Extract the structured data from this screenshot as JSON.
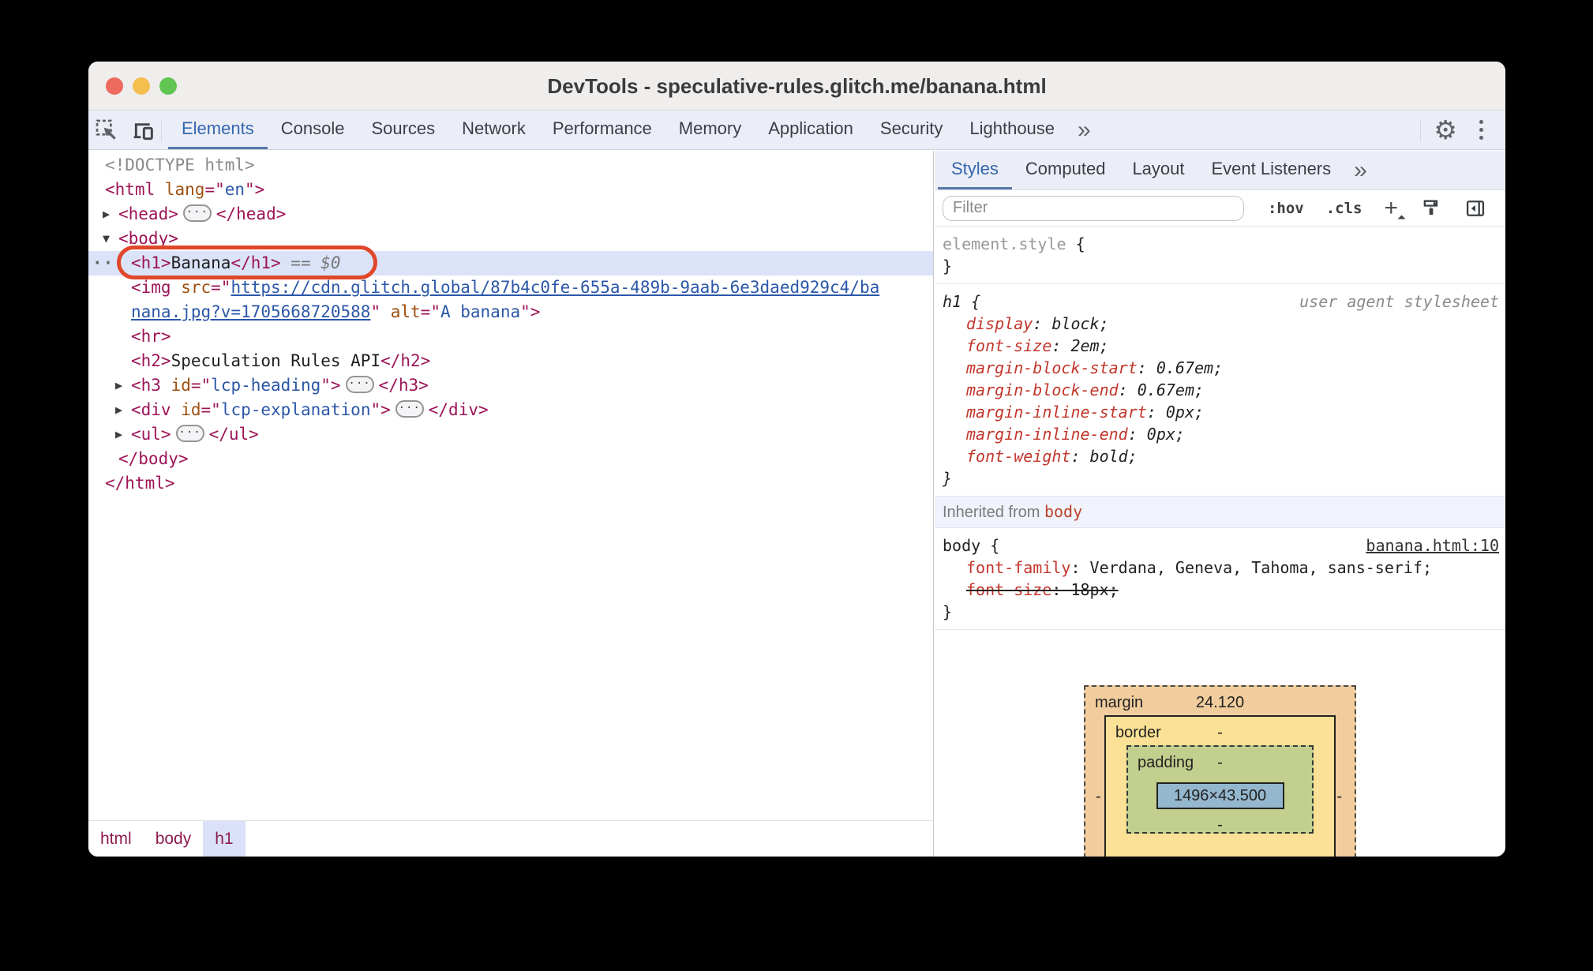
{
  "window": {
    "title": "DevTools - speculative-rules.glitch.me/banana.html"
  },
  "toolbar": {
    "tabs": [
      {
        "label": "Elements",
        "selected": true
      },
      {
        "label": "Console"
      },
      {
        "label": "Sources"
      },
      {
        "label": "Network"
      },
      {
        "label": "Performance"
      },
      {
        "label": "Memory"
      },
      {
        "label": "Application"
      },
      {
        "label": "Security"
      },
      {
        "label": "Lighthouse"
      }
    ],
    "more": "»"
  },
  "right_tabs": {
    "tabs": [
      {
        "label": "Styles",
        "selected": true
      },
      {
        "label": "Computed"
      },
      {
        "label": "Layout"
      },
      {
        "label": "Event Listeners"
      }
    ],
    "more": "»"
  },
  "styles_toolbar": {
    "filter_placeholder": "Filter",
    "pseudo": ":hov",
    "classes": ".cls",
    "plus": "+"
  },
  "rules": {
    "element_style": {
      "selector": "element.style",
      "open": " {",
      "close": "}"
    },
    "h1": {
      "selector": "h1 {",
      "origin": "user agent stylesheet",
      "close": "}",
      "decls": [
        {
          "name": "display",
          "value": "block"
        },
        {
          "name": "font-size",
          "value": "2em"
        },
        {
          "name": "margin-block-start",
          "value": "0.67em"
        },
        {
          "name": "margin-block-end",
          "value": "0.67em"
        },
        {
          "name": "margin-inline-start",
          "value": "0px"
        },
        {
          "name": "margin-inline-end",
          "value": "0px"
        },
        {
          "name": "font-weight",
          "value": "bold"
        }
      ]
    },
    "inherited": {
      "prefix": "Inherited from ",
      "node": "body"
    },
    "body": {
      "selector": "body {",
      "origin": "banana.html:10",
      "close": "}",
      "decls": [
        {
          "name": "font-family",
          "value": "Verdana, Geneva, Tahoma, sans-serif"
        },
        {
          "name": "font-size",
          "value": "18px",
          "strike": true
        }
      ]
    }
  },
  "box_model": {
    "margin_label": "margin",
    "margin_top": "24.120",
    "border_label": "border",
    "padding_label": "padding",
    "content_size": "1496×43.500",
    "dash": "-"
  },
  "breadcrumbs": [
    {
      "label": "html"
    },
    {
      "label": "body"
    },
    {
      "label": "h1",
      "active": true
    }
  ],
  "dom": {
    "rows": [
      {
        "indent": 0,
        "tokens": [
          {
            "g": "<!DOCTYPE html>"
          }
        ]
      },
      {
        "indent": 0,
        "tokens": [
          {
            "t": "<html "
          },
          {
            "a": "lang"
          },
          {
            "t": "=\""
          },
          {
            "v": "en"
          },
          {
            "t": "\">"
          }
        ]
      },
      {
        "indent": 1,
        "arrow": "▶",
        "tokens": [
          {
            "t": "<head>"
          },
          {
            "e": "···"
          },
          {
            "t": "</head>"
          }
        ]
      },
      {
        "indent": 1,
        "arrow": "▼",
        "tokens": [
          {
            "t": "<body>"
          }
        ]
      },
      {
        "indent": 2,
        "selected": true,
        "annotate": true,
        "gutter": "···",
        "tokens": [
          {
            "t": "<h1>"
          },
          {
            "p": "Banana"
          },
          {
            "t": "</h1>"
          },
          {
            "d": " == $0"
          }
        ]
      },
      {
        "indent": 2,
        "tokens": [
          {
            "t": "<img "
          },
          {
            "a": "src"
          },
          {
            "t": "=\""
          },
          {
            "l": "https://cdn.glitch.global/87b4c0fe-655a-489b-9aab-6e3daed929c4/ba"
          }
        ]
      },
      {
        "indent": 2,
        "tokens": [
          {
            "l": "nana.jpg?v=1705668720588"
          },
          {
            "t": "\" "
          },
          {
            "a": "alt"
          },
          {
            "t": "=\""
          },
          {
            "v": "A banana"
          },
          {
            "t": "\">"
          }
        ]
      },
      {
        "indent": 2,
        "tokens": [
          {
            "t": "<hr>"
          }
        ]
      },
      {
        "indent": 2,
        "tokens": [
          {
            "t": "<h2>"
          },
          {
            "p": "Speculation Rules API"
          },
          {
            "t": "</h2>"
          }
        ]
      },
      {
        "indent": 2,
        "arrow": "▶",
        "tokens": [
          {
            "t": "<h3 "
          },
          {
            "a": "id"
          },
          {
            "t": "=\""
          },
          {
            "v": "lcp-heading"
          },
          {
            "t": "\">"
          },
          {
            "e": "···"
          },
          {
            "t": "</h3>"
          }
        ]
      },
      {
        "indent": 2,
        "arrow": "▶",
        "tokens": [
          {
            "t": "<div "
          },
          {
            "a": "id"
          },
          {
            "t": "=\""
          },
          {
            "v": "lcp-explanation"
          },
          {
            "t": "\">"
          },
          {
            "e": "···"
          },
          {
            "t": "</div>"
          }
        ]
      },
      {
        "indent": 2,
        "arrow": "▶",
        "tokens": [
          {
            "t": "<ul>"
          },
          {
            "e": "···"
          },
          {
            "t": "</ul>"
          }
        ]
      },
      {
        "indent": 1,
        "tokens": [
          {
            "t": "</body>"
          }
        ]
      },
      {
        "indent": 0,
        "tokens": [
          {
            "t": "</html>"
          }
        ]
      }
    ]
  }
}
